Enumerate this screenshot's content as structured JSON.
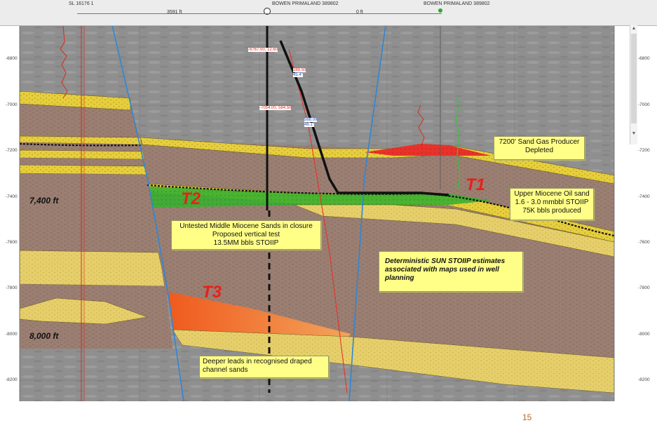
{
  "header": {
    "well_left": "SL 16176 1",
    "distance_left": "3591 ft",
    "well_center": "BOWEN PRIMALAND 389802",
    "distance_right": "0 ft",
    "well_right": "BOWEN PRIMALAND 389802"
  },
  "depth_axis": {
    "ticks": [
      "-6800",
      "-7000",
      "-7200",
      "-7400",
      "-7600",
      "-7800",
      "-8000",
      "-8200"
    ]
  },
  "depth_labels": {
    "upper": "7,400 ft",
    "lower": "8,000 ft"
  },
  "targets": {
    "t1": "T1",
    "t2": "T2",
    "t3": "T3"
  },
  "callouts": {
    "gas_producer": [
      "7200' Sand Gas Producer",
      "Depleted"
    ],
    "upper_miocene": [
      "Upper Miocene Oil sand",
      "1.6 - 3.0 mmbbl STOIIP",
      "75K bbls produced"
    ],
    "middle_miocene": [
      "Untested Middle Miocene Sands in closure",
      "Proposed vertical test",
      "13.5MM bbls STOIIP"
    ],
    "deterministic": [
      "Deterministic SUN STOIIP estimates",
      "associated with maps used in well",
      "planning"
    ],
    "deeper_leads": [
      "Deeper leads in recognised draped",
      "channel sands"
    ]
  },
  "well_annotations": {
    "a1": "-6767.00, 12.60",
    "a2": "289.50",
    "a3": "45.4°",
    "a4": "-7054.00, 584.50",
    "a5": "568.09",
    "a6": "46.1°"
  },
  "page_number": "15",
  "colors": {
    "shale": "#9b7f72",
    "sand": "#e7cf3c",
    "gas": "#e8322a",
    "oil": "#38b030",
    "background": "#8e8e8e",
    "fault": "#2f86d4",
    "target_text": "#e8201a",
    "callout": "#ffff88"
  }
}
